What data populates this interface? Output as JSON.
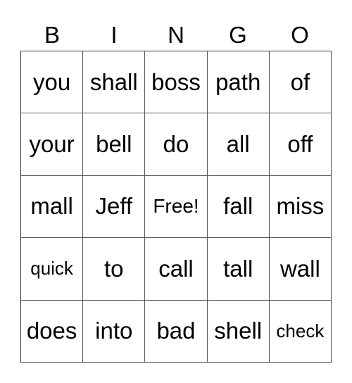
{
  "card": {
    "header": [
      "B",
      "I",
      "N",
      "G",
      "O"
    ],
    "rows": [
      [
        "you",
        "shall",
        "boss",
        "path",
        "of"
      ],
      [
        "your",
        "bell",
        "do",
        "all",
        "off"
      ],
      [
        "mall",
        "Jeff",
        "Free!",
        "fall",
        "miss"
      ],
      [
        "quick",
        "to",
        "call",
        "tall",
        "wall"
      ],
      [
        "does",
        "into",
        "bad",
        "shell",
        "check"
      ]
    ]
  }
}
